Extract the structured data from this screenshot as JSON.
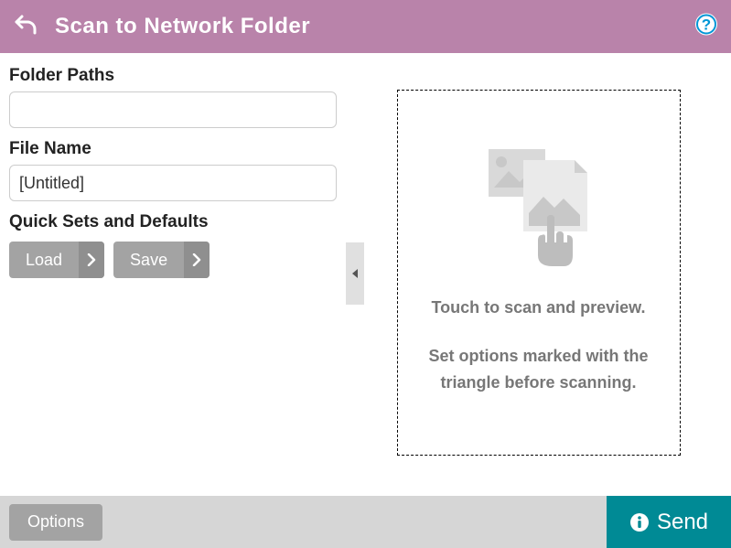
{
  "header": {
    "title": "Scan to Network Folder"
  },
  "form": {
    "folder_paths_label": "Folder Paths",
    "folder_paths_value": "",
    "file_name_label": "File Name",
    "file_name_value": "[Untitled]",
    "quicksets_label": "Quick Sets and Defaults",
    "load_label": "Load",
    "save_label": "Save"
  },
  "preview": {
    "line1": "Touch to scan and preview.",
    "line2": "Set options marked with the triangle before scanning."
  },
  "footer": {
    "options_label": "Options",
    "send_label": "Send"
  }
}
